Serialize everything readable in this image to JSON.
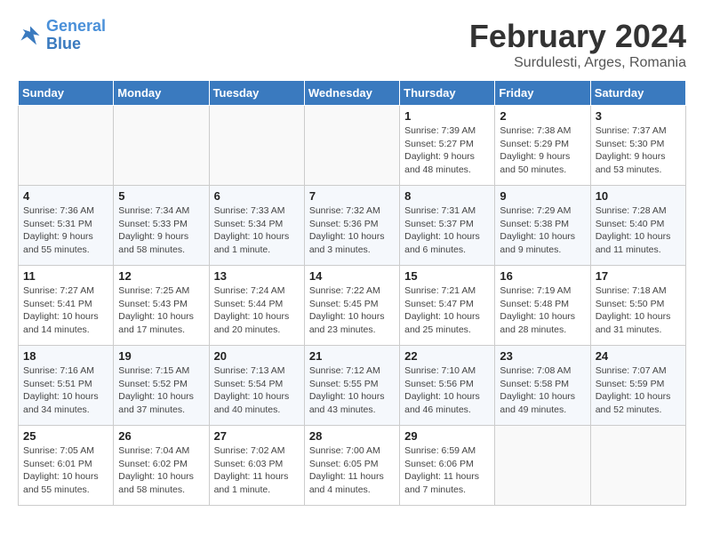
{
  "logo": {
    "line1": "General",
    "line2": "Blue"
  },
  "title": "February 2024",
  "subtitle": "Surdulesti, Arges, Romania",
  "days_of_week": [
    "Sunday",
    "Monday",
    "Tuesday",
    "Wednesday",
    "Thursday",
    "Friday",
    "Saturday"
  ],
  "weeks": [
    [
      {
        "day": "",
        "info": ""
      },
      {
        "day": "",
        "info": ""
      },
      {
        "day": "",
        "info": ""
      },
      {
        "day": "",
        "info": ""
      },
      {
        "day": "1",
        "info": "Sunrise: 7:39 AM\nSunset: 5:27 PM\nDaylight: 9 hours and 48 minutes."
      },
      {
        "day": "2",
        "info": "Sunrise: 7:38 AM\nSunset: 5:29 PM\nDaylight: 9 hours and 50 minutes."
      },
      {
        "day": "3",
        "info": "Sunrise: 7:37 AM\nSunset: 5:30 PM\nDaylight: 9 hours and 53 minutes."
      }
    ],
    [
      {
        "day": "4",
        "info": "Sunrise: 7:36 AM\nSunset: 5:31 PM\nDaylight: 9 hours and 55 minutes."
      },
      {
        "day": "5",
        "info": "Sunrise: 7:34 AM\nSunset: 5:33 PM\nDaylight: 9 hours and 58 minutes."
      },
      {
        "day": "6",
        "info": "Sunrise: 7:33 AM\nSunset: 5:34 PM\nDaylight: 10 hours and 1 minute."
      },
      {
        "day": "7",
        "info": "Sunrise: 7:32 AM\nSunset: 5:36 PM\nDaylight: 10 hours and 3 minutes."
      },
      {
        "day": "8",
        "info": "Sunrise: 7:31 AM\nSunset: 5:37 PM\nDaylight: 10 hours and 6 minutes."
      },
      {
        "day": "9",
        "info": "Sunrise: 7:29 AM\nSunset: 5:38 PM\nDaylight: 10 hours and 9 minutes."
      },
      {
        "day": "10",
        "info": "Sunrise: 7:28 AM\nSunset: 5:40 PM\nDaylight: 10 hours and 11 minutes."
      }
    ],
    [
      {
        "day": "11",
        "info": "Sunrise: 7:27 AM\nSunset: 5:41 PM\nDaylight: 10 hours and 14 minutes."
      },
      {
        "day": "12",
        "info": "Sunrise: 7:25 AM\nSunset: 5:43 PM\nDaylight: 10 hours and 17 minutes."
      },
      {
        "day": "13",
        "info": "Sunrise: 7:24 AM\nSunset: 5:44 PM\nDaylight: 10 hours and 20 minutes."
      },
      {
        "day": "14",
        "info": "Sunrise: 7:22 AM\nSunset: 5:45 PM\nDaylight: 10 hours and 23 minutes."
      },
      {
        "day": "15",
        "info": "Sunrise: 7:21 AM\nSunset: 5:47 PM\nDaylight: 10 hours and 25 minutes."
      },
      {
        "day": "16",
        "info": "Sunrise: 7:19 AM\nSunset: 5:48 PM\nDaylight: 10 hours and 28 minutes."
      },
      {
        "day": "17",
        "info": "Sunrise: 7:18 AM\nSunset: 5:50 PM\nDaylight: 10 hours and 31 minutes."
      }
    ],
    [
      {
        "day": "18",
        "info": "Sunrise: 7:16 AM\nSunset: 5:51 PM\nDaylight: 10 hours and 34 minutes."
      },
      {
        "day": "19",
        "info": "Sunrise: 7:15 AM\nSunset: 5:52 PM\nDaylight: 10 hours and 37 minutes."
      },
      {
        "day": "20",
        "info": "Sunrise: 7:13 AM\nSunset: 5:54 PM\nDaylight: 10 hours and 40 minutes."
      },
      {
        "day": "21",
        "info": "Sunrise: 7:12 AM\nSunset: 5:55 PM\nDaylight: 10 hours and 43 minutes."
      },
      {
        "day": "22",
        "info": "Sunrise: 7:10 AM\nSunset: 5:56 PM\nDaylight: 10 hours and 46 minutes."
      },
      {
        "day": "23",
        "info": "Sunrise: 7:08 AM\nSunset: 5:58 PM\nDaylight: 10 hours and 49 minutes."
      },
      {
        "day": "24",
        "info": "Sunrise: 7:07 AM\nSunset: 5:59 PM\nDaylight: 10 hours and 52 minutes."
      }
    ],
    [
      {
        "day": "25",
        "info": "Sunrise: 7:05 AM\nSunset: 6:01 PM\nDaylight: 10 hours and 55 minutes."
      },
      {
        "day": "26",
        "info": "Sunrise: 7:04 AM\nSunset: 6:02 PM\nDaylight: 10 hours and 58 minutes."
      },
      {
        "day": "27",
        "info": "Sunrise: 7:02 AM\nSunset: 6:03 PM\nDaylight: 11 hours and 1 minute."
      },
      {
        "day": "28",
        "info": "Sunrise: 7:00 AM\nSunset: 6:05 PM\nDaylight: 11 hours and 4 minutes."
      },
      {
        "day": "29",
        "info": "Sunrise: 6:59 AM\nSunset: 6:06 PM\nDaylight: 11 hours and 7 minutes."
      },
      {
        "day": "",
        "info": ""
      },
      {
        "day": "",
        "info": ""
      }
    ]
  ]
}
